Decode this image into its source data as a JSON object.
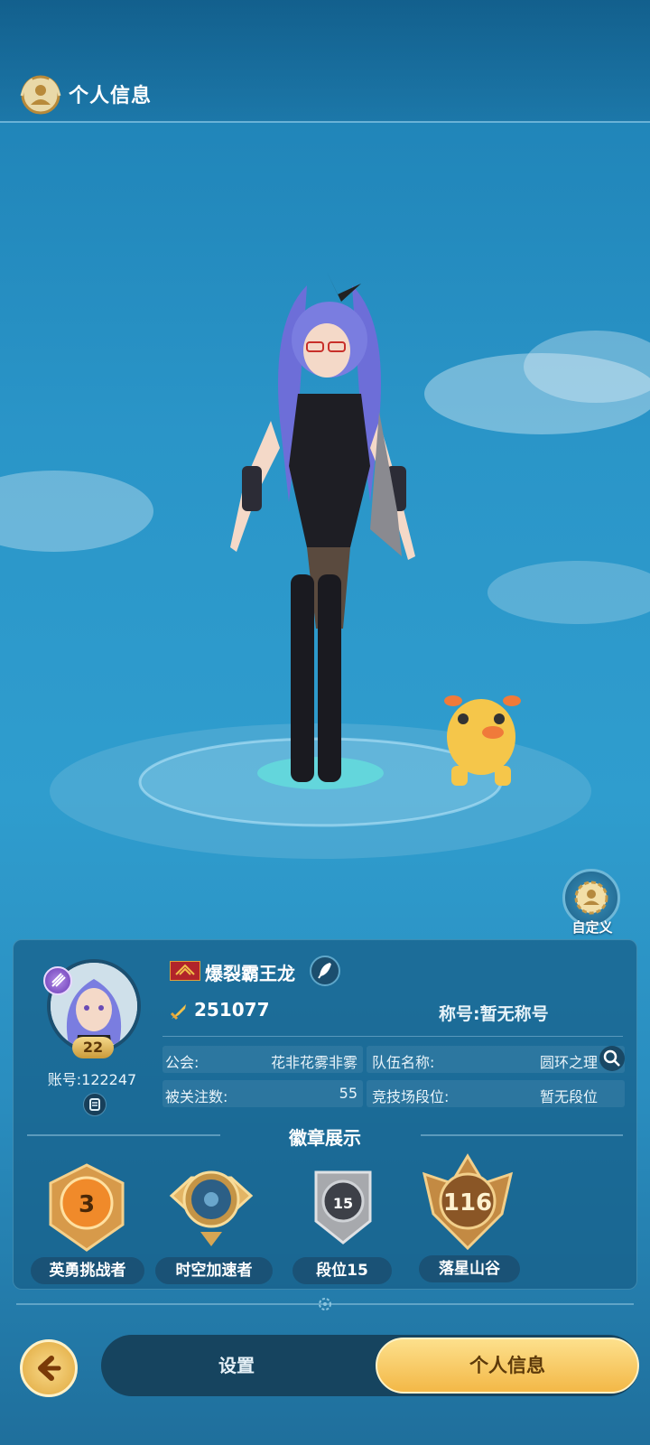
{
  "header": {
    "title": "个人信息"
  },
  "scene": {
    "customize_label": "自定义"
  },
  "player": {
    "name": "爆裂霸王龙",
    "level": "22",
    "account": "账号:122247",
    "power": "251077",
    "title": "称号:暂无称号",
    "guild_label": "公会:",
    "guild_value": "花非花雾非雾",
    "team_label": "队伍名称:",
    "team_value": "圆环之理",
    "followers_label": "被关注数:",
    "followers_value": "55",
    "arena_label": "竞技场段位:",
    "arena_value": "暂无段位"
  },
  "badges": {
    "section_title": "徽章展示",
    "items": [
      {
        "label": "英勇挑战者",
        "number": "3"
      },
      {
        "label": "时空加速者",
        "number": ""
      },
      {
        "label": "段位15",
        "number": "15"
      },
      {
        "label": "落星山谷",
        "number": "116"
      }
    ]
  },
  "nav": {
    "settings_label": "设置",
    "profile_label": "个人信息"
  },
  "colors": {
    "accent_gold": "#f3b847",
    "panel_blue": "#165e88",
    "sky_blue": "#2a95c8"
  }
}
